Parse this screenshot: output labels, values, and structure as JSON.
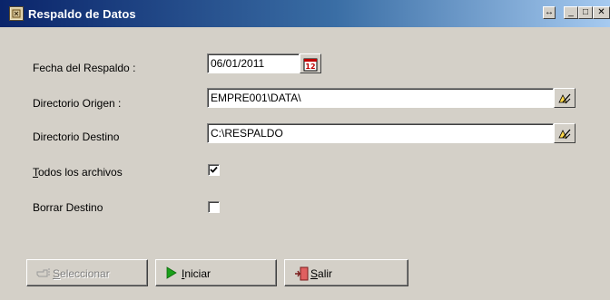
{
  "window": {
    "title": "Respaldo de Datos",
    "controls": {
      "resize": "↔",
      "minimize": "_",
      "maximize": "□",
      "close": "✕"
    }
  },
  "form": {
    "fecha": {
      "label": "Fecha del Respaldo :",
      "value": "06/01/2011",
      "icon": "calendar-icon"
    },
    "origen": {
      "label": "Directorio Origen :",
      "value": "EMPRE001\\DATA\\",
      "icon": "folder-browse-icon"
    },
    "destino": {
      "label": "Directorio Destino",
      "value": "C:\\RESPALDO",
      "icon": "folder-browse-icon"
    },
    "todos": {
      "label_first": "T",
      "label_rest": "odos los archivos",
      "checked": true
    },
    "borrar": {
      "label": "Borrar Destino",
      "checked": false
    }
  },
  "buttons": {
    "seleccionar": {
      "label_first": "S",
      "label_rest": "eleccionar",
      "enabled": false,
      "icon": "hand-pointer-icon"
    },
    "iniciar": {
      "label_first": "I",
      "label_rest": "niciar",
      "enabled": true,
      "icon": "play-icon"
    },
    "salir": {
      "label_first": "S",
      "label_rest": "alir",
      "enabled": true,
      "icon": "exit-door-icon"
    }
  },
  "colors": {
    "titlebar_start": "#0a246a",
    "titlebar_end": "#a6caf0",
    "face": "#d4d0c8",
    "play_green": "#1aa01a"
  }
}
